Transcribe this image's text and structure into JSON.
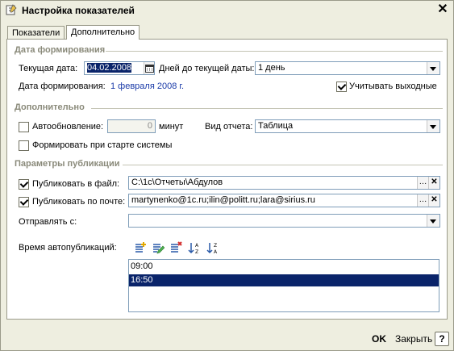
{
  "window": {
    "title": "Настройка показателей",
    "close_glyph": "✕"
  },
  "tabs": [
    {
      "label": "Показатели",
      "active": false
    },
    {
      "label": "Дополнительно",
      "active": true
    }
  ],
  "date_section": {
    "title": "Дата формирования",
    "current_date_label": "Текущая дата:",
    "current_date_value": "04.02.2008",
    "days_label": "Дней до текущей даты:",
    "days_value": "1 день",
    "formation_date_label": "Дата формирования:",
    "formation_date_value": "1 февраля 2008 г.",
    "weekends_label": "Учитывать выходные",
    "weekends_checked": true
  },
  "extra_section": {
    "title": "Дополнительно",
    "autoupdate_label": "Автообновление:",
    "autoupdate_checked": false,
    "autoupdate_value": "0",
    "autoupdate_unit": "минут",
    "report_view_label": "Вид отчета:",
    "report_view_value": "Таблица",
    "startup_label": "Формировать при старте системы",
    "startup_checked": false
  },
  "publish_section": {
    "title": "Параметры публикации",
    "file_label": "Публиковать в файл:",
    "file_checked": true,
    "file_value": "C:\\1c\\Отчеты\\Абдулов",
    "mail_label": "Публиковать по почте:",
    "mail_checked": true,
    "mail_value": "martynenko@1c.ru;ilin@politt.ru;lara@sirius.ru",
    "send_from_label": "Отправлять с:",
    "send_from_value": "",
    "autopub_label": "Время автопубликаций:",
    "times": [
      "09:00",
      "16:50"
    ],
    "selected_time_index": 1,
    "toolbar_icons": [
      "add-icon",
      "edit-icon",
      "delete-icon",
      "sort-ascending-icon",
      "sort-descending-icon"
    ]
  },
  "footer": {
    "ok_label": "OK",
    "close_label": "Закрыть",
    "help_label": "?"
  },
  "colors": {
    "window_bg": "#eeeee0",
    "selection": "#0a246a",
    "link_blue": "#1a3aa8"
  }
}
